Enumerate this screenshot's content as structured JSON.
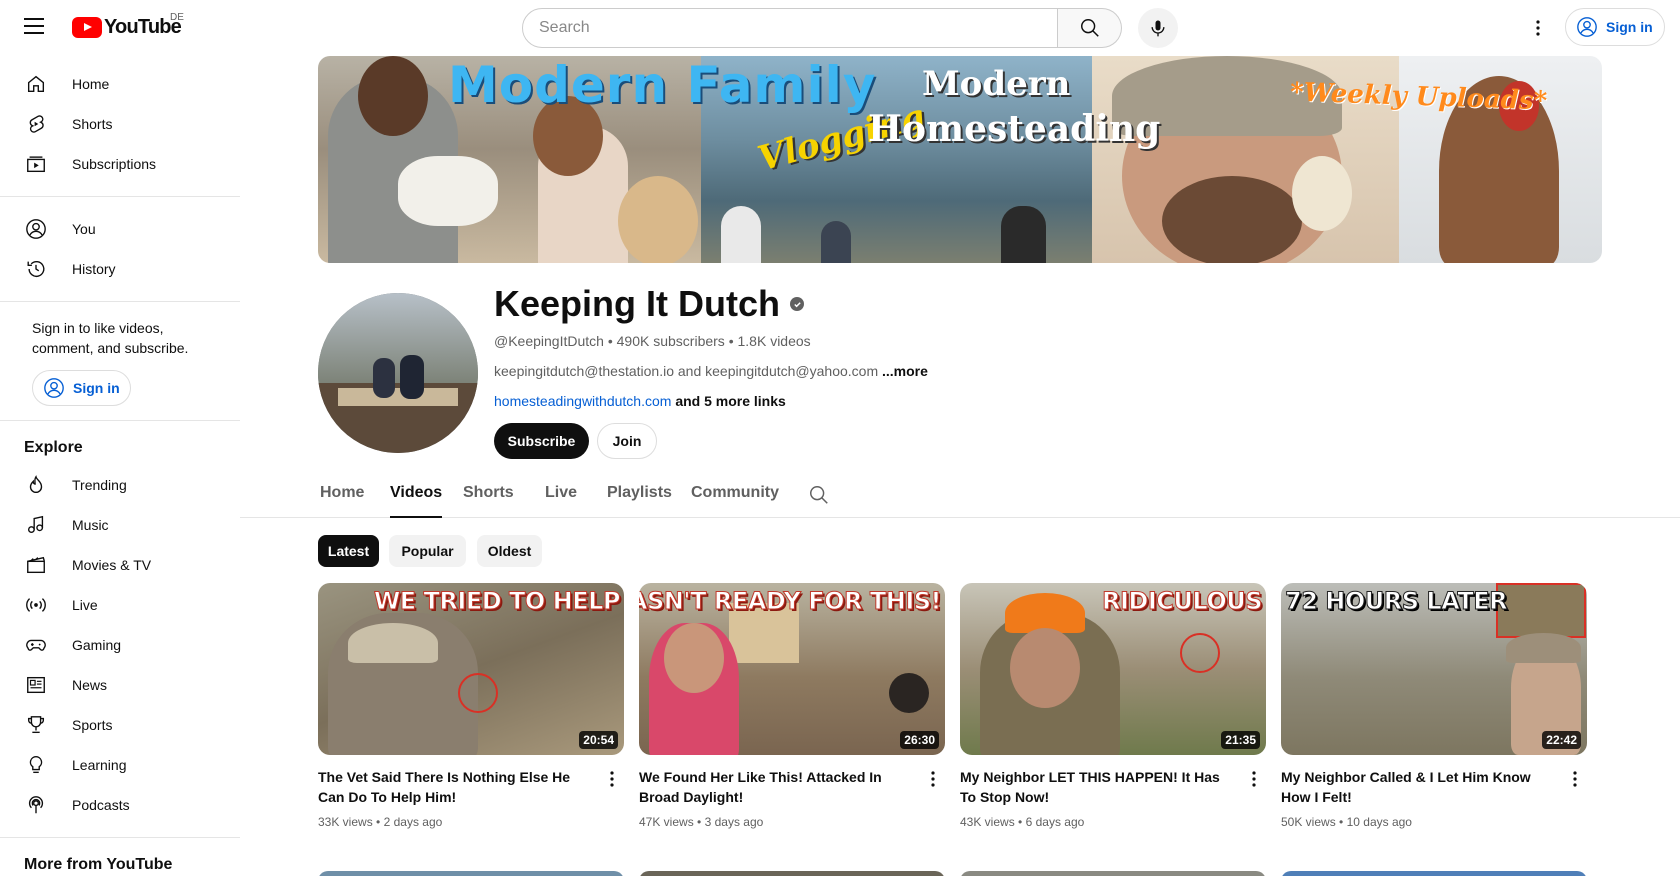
{
  "topbar": {
    "logo_text": "YouTube",
    "country_code": "DE",
    "search_placeholder": "Search",
    "signin_label": "Sign in"
  },
  "sidebar": {
    "primary": [
      {
        "label": "Home",
        "icon": "home-icon"
      },
      {
        "label": "Shorts",
        "icon": "shorts-icon"
      },
      {
        "label": "Subscriptions",
        "icon": "subscriptions-icon"
      }
    ],
    "you": [
      {
        "label": "You",
        "icon": "you-icon"
      },
      {
        "label": "History",
        "icon": "history-icon"
      }
    ],
    "signin_text": "Sign in to like videos, comment, and subscribe.",
    "signin_label": "Sign in",
    "explore_heading": "Explore",
    "explore": [
      {
        "label": "Trending",
        "icon": "trending-icon"
      },
      {
        "label": "Music",
        "icon": "music-icon"
      },
      {
        "label": "Movies & TV",
        "icon": "movies-icon"
      },
      {
        "label": "Live",
        "icon": "live-icon"
      },
      {
        "label": "Gaming",
        "icon": "gaming-icon"
      },
      {
        "label": "News",
        "icon": "news-icon"
      },
      {
        "label": "Sports",
        "icon": "sports-icon"
      },
      {
        "label": "Learning",
        "icon": "learning-icon"
      },
      {
        "label": "Podcasts",
        "icon": "podcasts-icon"
      }
    ],
    "more_heading": "More from YouTube"
  },
  "banner": {
    "line1": "Modern Family",
    "line2": "Vlogging",
    "line3": "Modern",
    "line4": "Homesteading",
    "line5": "*Weekly Uploads*"
  },
  "channel": {
    "name": "Keeping It Dutch",
    "handle": "@KeepingItDutch",
    "subscribers": "490K subscribers",
    "videos": "1.8K videos",
    "description": "keepingitdutch@thestation.io and keepingitdutch@yahoo.com",
    "more_label": "...more",
    "link": "homesteadingwithdutch.com",
    "more_links": "and 5 more links",
    "subscribe_label": "Subscribe",
    "join_label": "Join"
  },
  "tabs": [
    "Home",
    "Videos",
    "Shorts",
    "Live",
    "Playlists",
    "Community"
  ],
  "active_tab": "Videos",
  "chips": [
    "Latest",
    "Popular",
    "Oldest"
  ],
  "active_chip": "Latest",
  "videos": [
    {
      "thumb_text": "WE TRIED TO HELP",
      "duration": "20:54",
      "title": "The Vet Said There Is Nothing Else He Can Do To Help Him!",
      "views": "33K views",
      "age": "2 days ago"
    },
    {
      "thumb_text": "WASN'T READY FOR THIS!",
      "duration": "26:30",
      "title": "We Found Her Like This! Attacked In Broad Daylight!",
      "views": "47K views",
      "age": "3 days ago"
    },
    {
      "thumb_text": "RIDICULOUS",
      "duration": "21:35",
      "title": "My Neighbor LET THIS HAPPEN! It Has To Stop Now!",
      "views": "43K views",
      "age": "6 days ago"
    },
    {
      "thumb_text": "72 HOURS LATER",
      "duration": "22:42",
      "title": "My Neighbor Called & I Let Him Know How I Felt!",
      "views": "50K views",
      "age": "10 days ago"
    }
  ],
  "colors": {
    "brand_red": "#ff0000",
    "link_blue": "#065fd4",
    "text_primary": "#0f0f0f",
    "text_secondary": "#606060"
  }
}
